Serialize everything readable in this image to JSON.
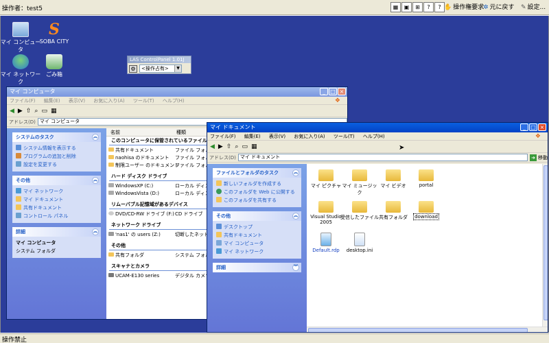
{
  "topbar": {
    "operator": "操作者：test5",
    "request_control": "操作権要求",
    "reset": "元に戻す",
    "settings": "設定..."
  },
  "status": {
    "text": "操作禁止"
  },
  "desktop": {
    "icons": [
      {
        "label": "マイ コンピュータ"
      },
      {
        "label": "SOBA CITY"
      },
      {
        "label": "マイ ネットワーク"
      },
      {
        "label": "ごみ箱"
      }
    ]
  },
  "las": {
    "title": "LAS ControlPanel 1.01J",
    "select_value": "<操作占有>"
  },
  "mycomputer": {
    "title": "マイ コンピュータ",
    "menu": [
      "ファイル(F)",
      "編集(E)",
      "表示(V)",
      "お気に入り(A)",
      "ツール(T)",
      "ヘルプ(H)"
    ],
    "address_label": "アドレス(D)",
    "address": "マイ コンピュータ",
    "tasks_title": "システムのタスク",
    "tasks": [
      "システム情報を表示する",
      "プログラムの追加と削除",
      "設定を変更する"
    ],
    "other_title": "その他",
    "other": [
      "マイ ネットワーク",
      "マイ ドキュメント",
      "共有ドキュメント",
      "コントロール パネル"
    ],
    "details_title": "詳細",
    "details_name": "マイ コンピュータ",
    "details_sub": "システム フォルダ",
    "col_name": "名前",
    "col_type": "種類",
    "groups": [
      {
        "title": "このコンピュータに保管されているファイル",
        "items": [
          {
            "name": "共有ドキュメント",
            "type": "ファイル フォルダ"
          },
          {
            "name": "naohisa のドキュメント",
            "type": "ファイル フォルダ"
          },
          {
            "name": "制限ユーザー のドキュメント",
            "type": "ファイル フォルダ"
          }
        ]
      },
      {
        "title": "ハード ディスク ドライブ",
        "items": [
          {
            "name": "WindowsXP (C:)",
            "type": "ローカル ディスク"
          },
          {
            "name": "WindowsVista (D:)",
            "type": "ローカル ディスク"
          }
        ]
      },
      {
        "title": "リムーバブル記憶域があるデバイス",
        "items": [
          {
            "name": "DVD/CD-RW ドライブ (F:)",
            "type": "CD ドライブ"
          }
        ]
      },
      {
        "title": "ネットワーク ドライブ",
        "items": [
          {
            "name": "'nas1' の users (Z:)",
            "type": "切断したネットワ"
          }
        ]
      },
      {
        "title": "その他",
        "items": [
          {
            "name": "共有フォルダ",
            "type": "システム フォルダ"
          }
        ]
      },
      {
        "title": "スキャナとカメラ",
        "items": [
          {
            "name": "UCAM-E130 series",
            "type": "デジタル カメラ"
          }
        ]
      }
    ]
  },
  "mydocs": {
    "title": "マイ ドキュメント",
    "menu": [
      "ファイル(F)",
      "編集(E)",
      "表示(V)",
      "お気に入り(A)",
      "ツール(T)",
      "ヘルプ(H)"
    ],
    "address_label": "アドレス(D)",
    "address": "マイ ドキュメント",
    "go_label": "移動",
    "tasks_title": "ファイルとフォルダのタスク",
    "tasks": [
      "新しいフォルダを作成する",
      "このフォルダを Web に公開する",
      "このフォルダを共有する"
    ],
    "other_title": "その他",
    "other": [
      "デスクトップ",
      "共有ドキュメント",
      "マイ コンピュータ",
      "マイ ネットワーク"
    ],
    "details_title": "詳細",
    "files": [
      {
        "label": "マイ ピクチャ",
        "kind": "folder"
      },
      {
        "label": "マイ ミュージック",
        "kind": "folder"
      },
      {
        "label": "マイ ビデオ",
        "kind": "folder"
      },
      {
        "label": "portal",
        "kind": "folder"
      },
      {
        "label": "Visual Studio 2005",
        "kind": "folder"
      },
      {
        "label": "受信したファイル",
        "kind": "folder"
      },
      {
        "label": "共有フォルダ",
        "kind": "folder"
      },
      {
        "label": "download",
        "kind": "folder"
      },
      {
        "label": "Default.rdp",
        "kind": "rdp"
      },
      {
        "label": "desktop.ini",
        "kind": "doc"
      }
    ]
  }
}
